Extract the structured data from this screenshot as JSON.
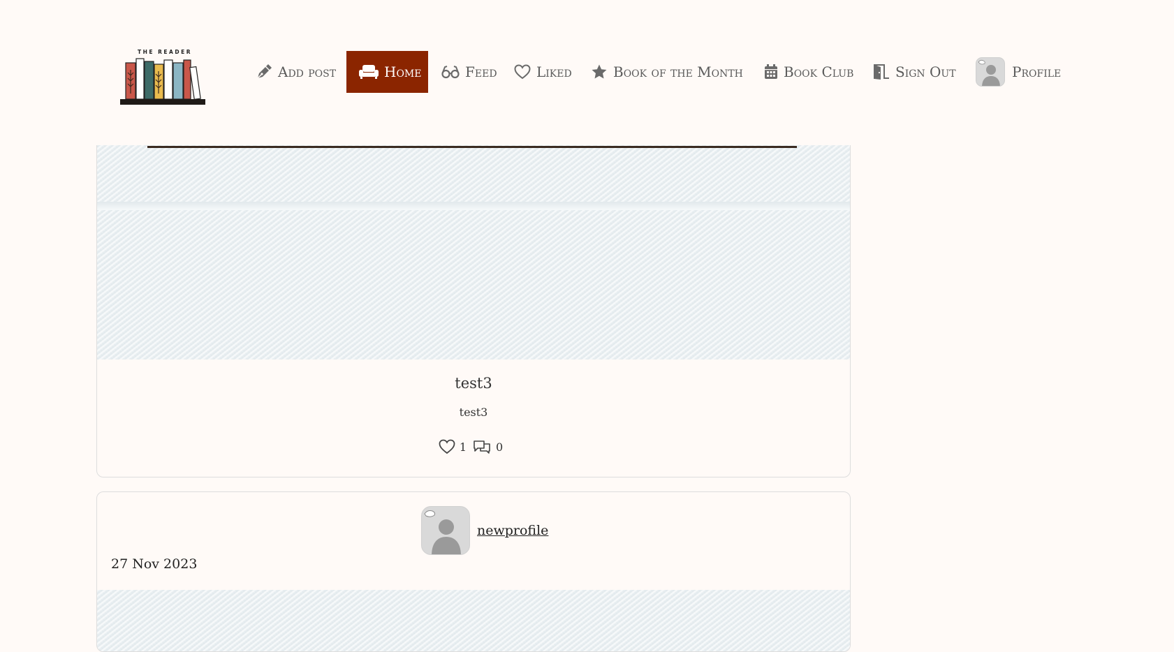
{
  "navbar": {
    "logo_text": "THE READER",
    "items": [
      {
        "label": "Add post",
        "icon": "pen-icon"
      },
      {
        "label": "Home",
        "icon": "couch-icon",
        "active": true
      },
      {
        "label": "Feed",
        "icon": "glasses-icon"
      },
      {
        "label": "Liked",
        "icon": "heart-icon"
      },
      {
        "label": "Book of the Month",
        "icon": "star-icon"
      },
      {
        "label": "Book Club",
        "icon": "calendar-icon"
      },
      {
        "label": "Sign Out",
        "icon": "door-icon"
      },
      {
        "label": "Profile",
        "icon": "avatar"
      }
    ]
  },
  "posts": [
    {
      "title": "test3",
      "excerpt": "test3",
      "likes": "1",
      "comments": "0"
    },
    {
      "author": "newprofile",
      "date": "27 Nov 2023"
    }
  ],
  "colors": {
    "accent": "#8b2500",
    "background": "#fffaf7",
    "nav_text": "#5a5a5a"
  }
}
